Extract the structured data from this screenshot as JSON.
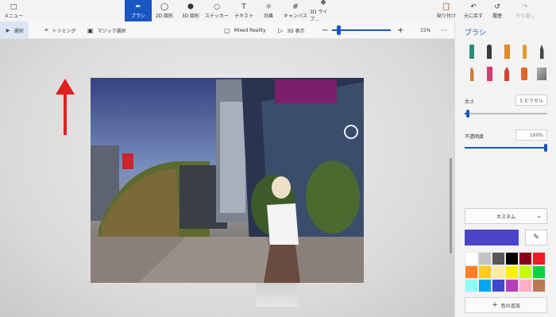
{
  "toolbar": {
    "menu": "メニュー",
    "brush": "ブラシ",
    "shapes2d": "2D 図形",
    "shapes3d": "3D 図形",
    "stickers": "ステッカー",
    "text": "テキスト",
    "effects": "効果",
    "canvas": "キャンバス",
    "library3d": "3D ライブ…",
    "paste": "貼り付け",
    "undo": "元に戻す",
    "history": "履歴",
    "redo": "やり直し"
  },
  "subbar": {
    "select": "選択",
    "crop": "トリミング",
    "magic_select": "マジック選択",
    "mixed_reality": "Mixed Reality",
    "view3d": "3D 表示",
    "zoom_value": "15%",
    "zoom_level": 0.15,
    "more": "···"
  },
  "panel": {
    "title": "ブラシ",
    "brushes": [
      {
        "icon": "marker-teal-icon",
        "color": "#2a8f7a"
      },
      {
        "icon": "calligraphy-pen-icon",
        "color": "#3a3a3a"
      },
      {
        "icon": "oil-brush-icon",
        "color": "#e08a2c"
      },
      {
        "icon": "watercolor-icon",
        "color": "#e59a2f"
      },
      {
        "icon": "pixel-pen-icon",
        "color": "#444444"
      },
      {
        "icon": "pencil-icon",
        "color": "#c87f3a"
      },
      {
        "icon": "eraser-icon",
        "color": "#d33b6b"
      },
      {
        "icon": "crayon-icon",
        "color": "#d9412f"
      },
      {
        "icon": "spray-can-icon",
        "color": "#e0652a"
      },
      {
        "icon": "fill-bucket-icon",
        "color": "#9a9a9a"
      }
    ],
    "thickness_label": "太さ",
    "thickness_value": "5 ピクセル",
    "thickness_level": 0.05,
    "opacity_label": "不透明度",
    "opacity_value": "100%",
    "opacity_level": 1.0,
    "color_mode": "カスタム",
    "current_color": "#4a45c8",
    "swatches": [
      "#ffffff",
      "#c3c3c3",
      "#585858",
      "#000000",
      "#88001b",
      "#ec1c24",
      "#ff7f27",
      "#ffca18",
      "#fdeca6",
      "#fff200",
      "#c4ff0e",
      "#0ed145",
      "#8cfffb",
      "#00a8f3",
      "#3f48cc",
      "#b83dba",
      "#ffaec8",
      "#b97a56"
    ],
    "add_color": "色の追加"
  }
}
